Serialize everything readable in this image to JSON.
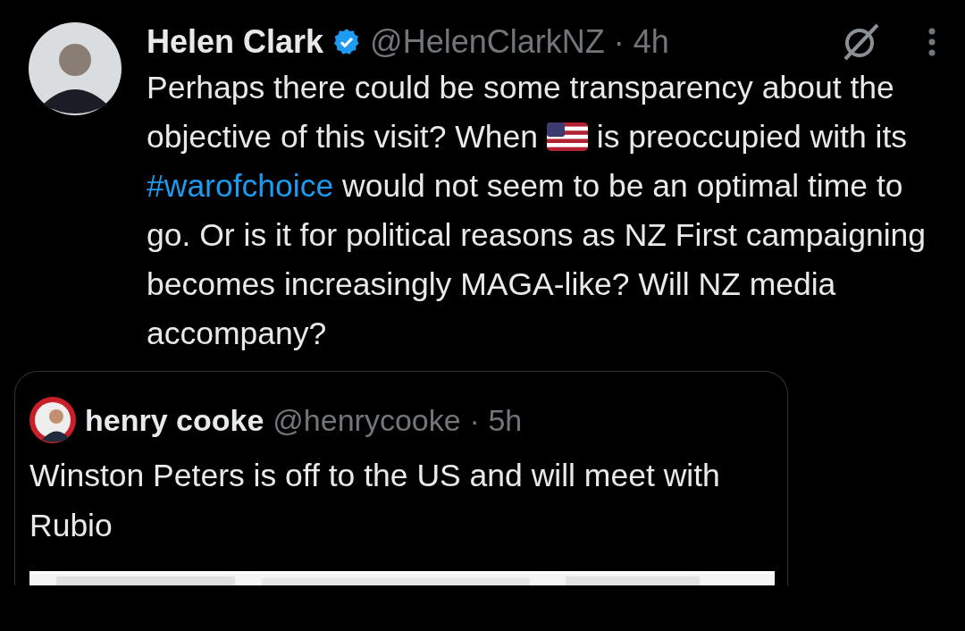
{
  "tweet": {
    "author": {
      "name": "Helen Clark",
      "verified": true,
      "handle": "@HelenClarkNZ",
      "time": "· 4h"
    },
    "text_before": "Perhaps there could be some transparency about the objective of this visit? When",
    "text_middle": "is preoccupied with its",
    "hashtag": "#warofchoice",
    "text_after": "would not seem to be an optimal time to go. Or is it for political reasons as NZ First campaigning becomes increasingly MAGA-like? Will NZ media accompany?",
    "quote": {
      "author": {
        "name": "henry cooke",
        "handle": "@henrycooke",
        "time": "· 5h"
      },
      "text": "Winston Peters is off to the US and will meet with Rubio"
    }
  }
}
